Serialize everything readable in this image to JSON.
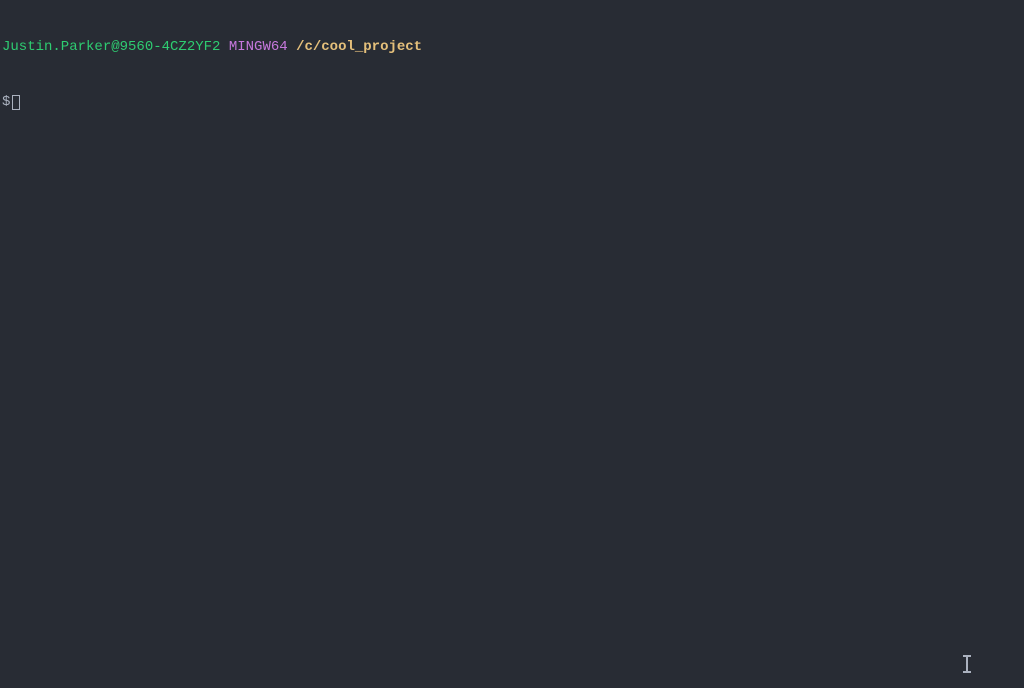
{
  "prompt": {
    "user_host": "Justin.Parker@9560-4CZ2YF2",
    "shell": "MINGW64",
    "path": "/c/cool_project",
    "symbol": "$"
  }
}
